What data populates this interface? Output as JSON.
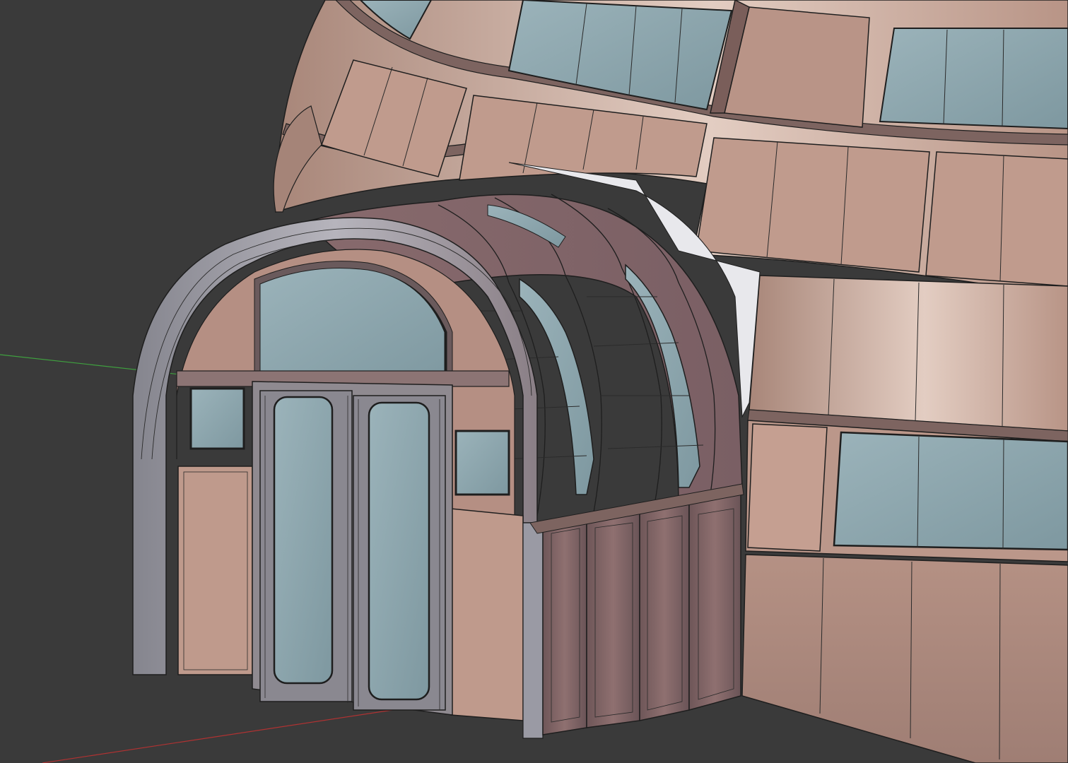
{
  "viewport": {
    "background": "#3a3a3a",
    "wall_color": "#c0988a",
    "wall_highlight": "#e6cfc4",
    "wall_shadow": "#8e6f6a",
    "glass_color": "#85a0a8",
    "frame_color": "#5e5a5c",
    "edge_color": "#1e1e1e",
    "arch_color": "#9a9aa4",
    "x_axis_color": "#b03232",
    "y_axis_color": "#3fa03f"
  }
}
